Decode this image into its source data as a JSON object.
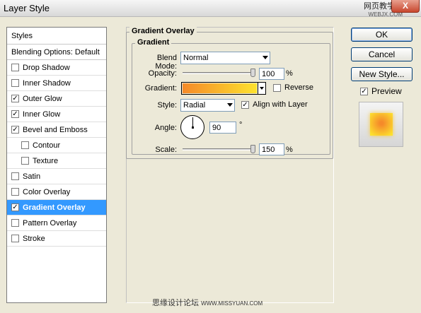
{
  "window": {
    "title": "Layer Style",
    "close_label": "X"
  },
  "watermark_top": {
    "line1": "网页教学网",
    "line2": "WEBJX.COM"
  },
  "styles_panel": {
    "header": "Styles",
    "blending_options": "Blending Options: Default",
    "effects": [
      {
        "label": "Drop Shadow",
        "checked": false,
        "sub": false,
        "selected": false
      },
      {
        "label": "Inner Shadow",
        "checked": false,
        "sub": false,
        "selected": false
      },
      {
        "label": "Outer Glow",
        "checked": true,
        "sub": false,
        "selected": false
      },
      {
        "label": "Inner Glow",
        "checked": true,
        "sub": false,
        "selected": false
      },
      {
        "label": "Bevel and Emboss",
        "checked": true,
        "sub": false,
        "selected": false
      },
      {
        "label": "Contour",
        "checked": false,
        "sub": true,
        "selected": false
      },
      {
        "label": "Texture",
        "checked": false,
        "sub": true,
        "selected": false
      },
      {
        "label": "Satin",
        "checked": false,
        "sub": false,
        "selected": false
      },
      {
        "label": "Color Overlay",
        "checked": false,
        "sub": false,
        "selected": false
      },
      {
        "label": "Gradient Overlay",
        "checked": true,
        "sub": false,
        "selected": true
      },
      {
        "label": "Pattern Overlay",
        "checked": false,
        "sub": false,
        "selected": false
      },
      {
        "label": "Stroke",
        "checked": false,
        "sub": false,
        "selected": false
      }
    ]
  },
  "gradient_overlay": {
    "section_title": "Gradient Overlay",
    "group_title": "Gradient",
    "blend_mode_label": "Blend Mode:",
    "blend_mode_value": "Normal",
    "opacity_label": "Opacity:",
    "opacity_value": "100",
    "opacity_fraction": 1.0,
    "percent_sign": "%",
    "gradient_label": "Gradient:",
    "gradient_colors": [
      "#f58a2a",
      "#fde22e"
    ],
    "reverse_label": "Reverse",
    "reverse_checked": false,
    "style_label": "Style:",
    "style_value": "Radial",
    "align_label": "Align with Layer",
    "align_checked": true,
    "angle_label": "Angle:",
    "angle_value": "90",
    "degree_sign": "°",
    "scale_label": "Scale:",
    "scale_value": "150",
    "scale_fraction": 1.0
  },
  "buttons": {
    "ok": "OK",
    "cancel": "Cancel",
    "new_style": "New Style...",
    "preview_label": "Preview",
    "preview_checked": true
  },
  "watermark_bottom": {
    "text": "思缘设计论坛",
    "site": "WWW.MISSYUAN.COM"
  },
  "colors": {
    "selection": "#3399ff",
    "dialog_bg": "#ece9d8"
  }
}
